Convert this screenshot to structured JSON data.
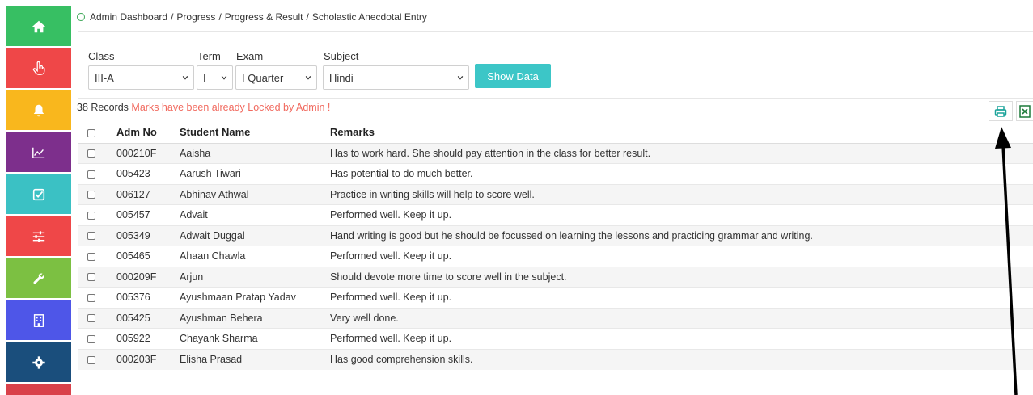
{
  "sidebar": {
    "items": [
      {
        "name": "home",
        "icon": "home-icon",
        "color": "#37bf63"
      },
      {
        "name": "hand",
        "icon": "hand-pointer-icon",
        "color": "#ef4748"
      },
      {
        "name": "notifications",
        "icon": "bell-icon",
        "color": "#f9b71d"
      },
      {
        "name": "charts",
        "icon": "line-chart-icon",
        "color": "#7d2f8c"
      },
      {
        "name": "tasks",
        "icon": "checkbox-icon",
        "color": "#3bc1c4"
      },
      {
        "name": "settings-sliders",
        "icon": "sliders-icon",
        "color": "#ef4748"
      },
      {
        "name": "tools",
        "icon": "wrench-icon",
        "color": "#7cc042"
      },
      {
        "name": "building",
        "icon": "building-icon",
        "color": "#4e56e8"
      },
      {
        "name": "gear",
        "icon": "gear-icon",
        "color": "#1a4e7c"
      },
      {
        "name": "extra",
        "icon": "none",
        "color": "#d9414a"
      }
    ]
  },
  "breadcrumb": {
    "items": [
      "Admin Dashboard",
      "Progress",
      "Progress & Result",
      "Scholastic Anecdotal Entry"
    ],
    "separator": "/"
  },
  "filters": {
    "class": {
      "label": "Class",
      "value": "III-A"
    },
    "term": {
      "label": "Term",
      "value": "I"
    },
    "exam": {
      "label": "Exam",
      "value": "I Quarter"
    },
    "subject": {
      "label": "Subject",
      "value": "Hindi"
    },
    "show_label": "Show Data"
  },
  "records": {
    "count": "38 Records",
    "locked_message": "Marks have been already Locked by Admin !"
  },
  "table": {
    "headers": [
      "Adm No",
      "Student Name",
      "Remarks"
    ],
    "rows": [
      [
        "000210F",
        "Aaisha",
        "Has to work hard. She should pay attention in the class for better result."
      ],
      [
        "005423",
        "Aarush Tiwari",
        "Has potential to do much better."
      ],
      [
        "006127",
        "Abhinav Athwal",
        "Practice in writing skills will help to score well."
      ],
      [
        "005457",
        "Advait",
        "Performed well. Keep it up."
      ],
      [
        "005349",
        "Adwait Duggal",
        "Hand writing is good but he should be focussed on learning the lessons and practicing grammar and writing."
      ],
      [
        "005465",
        "Ahaan Chawla",
        "Performed well. Keep it up."
      ],
      [
        "000209F",
        "Arjun",
        "Should devote more time to score well in the subject."
      ],
      [
        "005376",
        "Ayushmaan Pratap Yadav",
        "Performed well. Keep it up."
      ],
      [
        "005425",
        "Ayushman Behera",
        "Very well done."
      ],
      [
        "005922",
        "Chayank Sharma",
        "Performed well. Keep it up."
      ],
      [
        "000203F",
        "Elisha Prasad",
        "Has good comprehension skills."
      ]
    ]
  },
  "colors": {
    "accent": "#3cc6c7",
    "locked": "#f16a5f",
    "print_icon": "#1aa39a",
    "excel_icon": "#1d7a3a"
  }
}
